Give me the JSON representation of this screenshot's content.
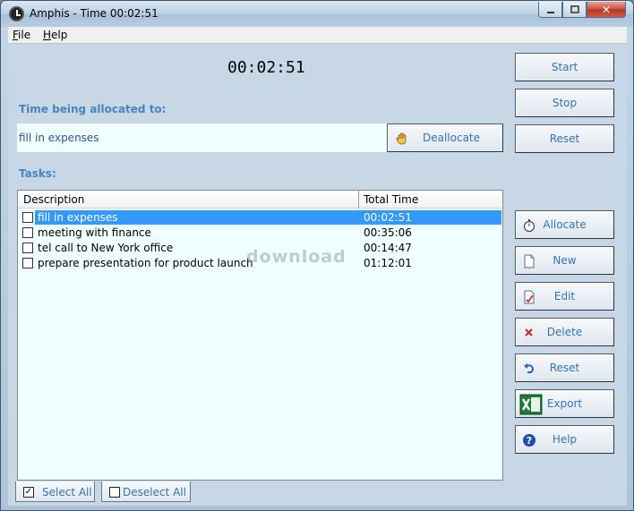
{
  "window": {
    "title": "Amphis - Time 00:02:51",
    "minimize_icon": "minimize-icon",
    "maximize_icon": "maximize-icon",
    "close_glyph": "✕"
  },
  "menu": {
    "items": [
      {
        "label": "File",
        "accel": "F",
        "rest": "ile"
      },
      {
        "label": "Help",
        "accel": "H",
        "rest": "elp"
      }
    ]
  },
  "timer": {
    "value": "00:02:51"
  },
  "allocation": {
    "label": "Time being allocated to:",
    "current_task": "fill in expenses",
    "deallocate_label": "Deallocate",
    "deallocate_icon": "hand-icon"
  },
  "tasks": {
    "label": "Tasks:",
    "columns": [
      "Description",
      "Total Time"
    ],
    "rows": [
      {
        "description": "fill in expenses",
        "total_time": "00:02:51",
        "checked": false,
        "selected": true
      },
      {
        "description": "meeting with finance",
        "total_time": "00:35:06",
        "checked": false,
        "selected": false
      },
      {
        "description": "tel call to New York office",
        "total_time": "00:14:47",
        "checked": false,
        "selected": false
      },
      {
        "description": "prepare presentation for product launch",
        "total_time": "01:12:01",
        "checked": false,
        "selected": false
      }
    ]
  },
  "watermark": {
    "text": "download"
  },
  "timer_buttons": {
    "start": "Start",
    "stop": "Stop",
    "reset": "Reset"
  },
  "task_buttons": {
    "allocate": "Allocate",
    "new": "New",
    "edit": "Edit",
    "delete": "Delete",
    "reset": "Reset",
    "export": "Export",
    "help": "Help"
  },
  "bottom": {
    "select_all": "Select All",
    "deselect_all": "Deselect All",
    "select_all_checked": true,
    "deselect_all_checked": false,
    "check_glyph": "✓"
  },
  "colors": {
    "accent_text": "#3573b3",
    "section_label": "#4a84b9",
    "selection": "#3399ff",
    "list_background": "#eefffe"
  }
}
